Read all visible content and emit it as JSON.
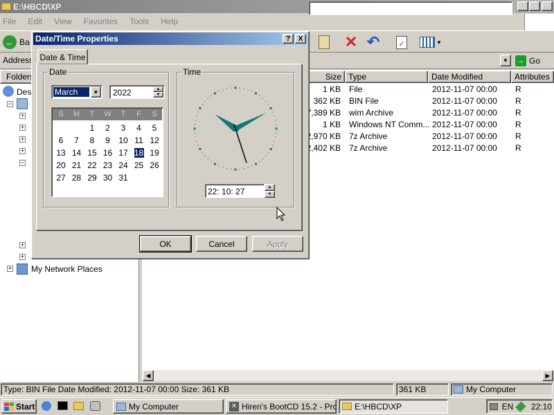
{
  "explorer": {
    "title": "E:\\HBCD\\XP",
    "menu": [
      "File",
      "Edit",
      "View",
      "Favorites",
      "Tools",
      "Help"
    ],
    "toolbar": {
      "back_label": "Ba"
    },
    "address": {
      "label": "Address",
      "go_label": "Go"
    },
    "folders": {
      "header": "Folders",
      "desktop_label": "Des",
      "network_label": "My Network Places"
    },
    "columns": [
      "Size",
      "Type",
      "Date Modified",
      "Attributes"
    ],
    "files": [
      {
        "size": "1 KB",
        "type": "File",
        "modified": "2012-11-07 00:00",
        "attr": "R"
      },
      {
        "size": "362 KB",
        "type": "BIN File",
        "modified": "2012-11-07 00:00",
        "attr": "R"
      },
      {
        "size": "7,389 KB",
        "type": "wim Archive",
        "modified": "2012-11-07 00:00",
        "attr": "R"
      },
      {
        "size": "1 KB",
        "type": "Windows NT Comm...",
        "modified": "2012-11-07 00:00",
        "attr": "R"
      },
      {
        "size": "2,970 KB",
        "type": "7z Archive",
        "modified": "2012-11-07 00:00",
        "attr": "R"
      },
      {
        "size": "2,402 KB",
        "type": "7z Archive",
        "modified": "2012-11-07 00:00",
        "attr": "R"
      }
    ],
    "status": {
      "description": "Type: BIN File Date Modified: 2012-11-07 00:00 Size: 361 KB",
      "size": "361 KB",
      "location": "My Computer"
    }
  },
  "dialog": {
    "title": "Date/Time Properties",
    "help_btn": "?",
    "close_btn": "X",
    "tab": "Date & Time",
    "date_group": "Date",
    "time_group": "Time",
    "month": "March",
    "year": "2022",
    "weekdays": [
      "S",
      "M",
      "T",
      "W",
      "T",
      "F",
      "S"
    ],
    "days": [
      "1",
      "2",
      "3",
      "4",
      "5",
      "6",
      "7",
      "8",
      "9",
      "10",
      "11",
      "12",
      "13",
      "14",
      "15",
      "16",
      "17",
      "18",
      "19",
      "20",
      "21",
      "22",
      "23",
      "24",
      "25",
      "26",
      "27",
      "28",
      "29",
      "30",
      "31"
    ],
    "selected_day": "18",
    "time": "22: 10: 27",
    "buttons": {
      "ok": "OK",
      "cancel": "Cancel",
      "apply": "Apply"
    },
    "colors": {
      "clock_hands": "#117a78",
      "clock_marks": "#117a78",
      "selected_bg": "#0a246a"
    }
  },
  "taskbar": {
    "start": "Start",
    "tasks": [
      {
        "label": "My Computer"
      },
      {
        "label": "Hiren's BootCD 15.2 - Pro..."
      },
      {
        "label": "E:\\HBCD\\XP"
      }
    ],
    "language": "EN",
    "clock": "22:10"
  }
}
